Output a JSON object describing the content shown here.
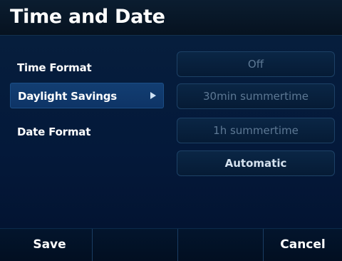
{
  "title": "Time and Date",
  "settings": [
    {
      "label": "Time Format",
      "selected": false
    },
    {
      "label": "Daylight Savings",
      "selected": true
    },
    {
      "label": "Date Format",
      "selected": false
    }
  ],
  "options": [
    {
      "label": "Off",
      "active": false
    },
    {
      "label": "30min summertime",
      "active": false
    },
    {
      "label": "1h summertime",
      "active": false
    },
    {
      "label": "Automatic",
      "active": true
    }
  ],
  "softkeys": [
    "Save",
    "",
    "",
    "Cancel"
  ],
  "icons": {
    "selected_arrow": "right-triangle-arrow-icon"
  },
  "colors": {
    "title_bg": "#081a2e",
    "content_bg": "#041a3a",
    "selected_row": "#123e72",
    "active_option_text": "#d4e1ee",
    "inactive_option_text": "#5d7894"
  }
}
